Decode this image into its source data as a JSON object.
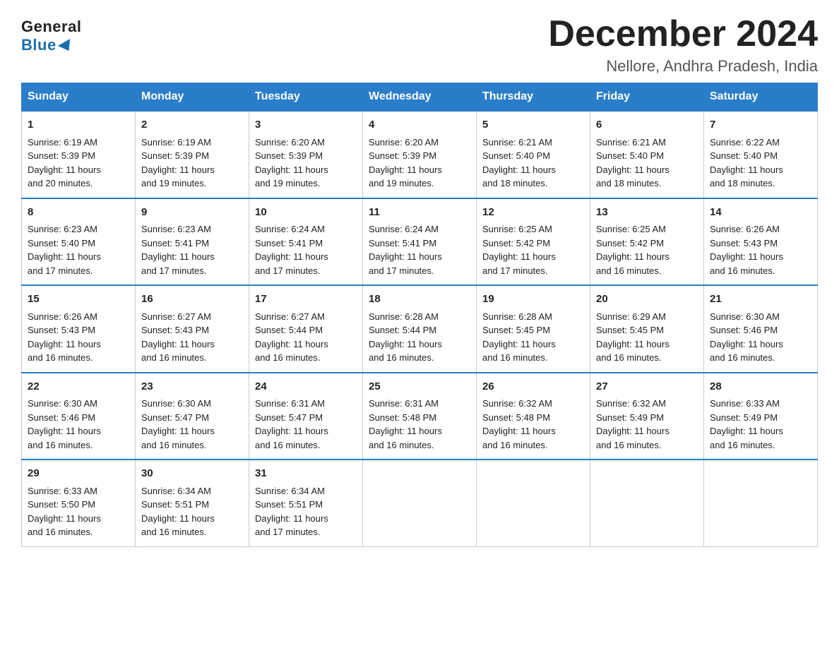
{
  "header": {
    "logo_general": "General",
    "logo_blue": "Blue",
    "month_title": "December 2024",
    "location": "Nellore, Andhra Pradesh, India"
  },
  "days_of_week": [
    "Sunday",
    "Monday",
    "Tuesday",
    "Wednesday",
    "Thursday",
    "Friday",
    "Saturday"
  ],
  "weeks": [
    [
      {
        "day": "1",
        "sunrise": "6:19 AM",
        "sunset": "5:39 PM",
        "daylight": "11 hours and 20 minutes."
      },
      {
        "day": "2",
        "sunrise": "6:19 AM",
        "sunset": "5:39 PM",
        "daylight": "11 hours and 19 minutes."
      },
      {
        "day": "3",
        "sunrise": "6:20 AM",
        "sunset": "5:39 PM",
        "daylight": "11 hours and 19 minutes."
      },
      {
        "day": "4",
        "sunrise": "6:20 AM",
        "sunset": "5:39 PM",
        "daylight": "11 hours and 19 minutes."
      },
      {
        "day": "5",
        "sunrise": "6:21 AM",
        "sunset": "5:40 PM",
        "daylight": "11 hours and 18 minutes."
      },
      {
        "day": "6",
        "sunrise": "6:21 AM",
        "sunset": "5:40 PM",
        "daylight": "11 hours and 18 minutes."
      },
      {
        "day": "7",
        "sunrise": "6:22 AM",
        "sunset": "5:40 PM",
        "daylight": "11 hours and 18 minutes."
      }
    ],
    [
      {
        "day": "8",
        "sunrise": "6:23 AM",
        "sunset": "5:40 PM",
        "daylight": "11 hours and 17 minutes."
      },
      {
        "day": "9",
        "sunrise": "6:23 AM",
        "sunset": "5:41 PM",
        "daylight": "11 hours and 17 minutes."
      },
      {
        "day": "10",
        "sunrise": "6:24 AM",
        "sunset": "5:41 PM",
        "daylight": "11 hours and 17 minutes."
      },
      {
        "day": "11",
        "sunrise": "6:24 AM",
        "sunset": "5:41 PM",
        "daylight": "11 hours and 17 minutes."
      },
      {
        "day": "12",
        "sunrise": "6:25 AM",
        "sunset": "5:42 PM",
        "daylight": "11 hours and 17 minutes."
      },
      {
        "day": "13",
        "sunrise": "6:25 AM",
        "sunset": "5:42 PM",
        "daylight": "11 hours and 16 minutes."
      },
      {
        "day": "14",
        "sunrise": "6:26 AM",
        "sunset": "5:43 PM",
        "daylight": "11 hours and 16 minutes."
      }
    ],
    [
      {
        "day": "15",
        "sunrise": "6:26 AM",
        "sunset": "5:43 PM",
        "daylight": "11 hours and 16 minutes."
      },
      {
        "day": "16",
        "sunrise": "6:27 AM",
        "sunset": "5:43 PM",
        "daylight": "11 hours and 16 minutes."
      },
      {
        "day": "17",
        "sunrise": "6:27 AM",
        "sunset": "5:44 PM",
        "daylight": "11 hours and 16 minutes."
      },
      {
        "day": "18",
        "sunrise": "6:28 AM",
        "sunset": "5:44 PM",
        "daylight": "11 hours and 16 minutes."
      },
      {
        "day": "19",
        "sunrise": "6:28 AM",
        "sunset": "5:45 PM",
        "daylight": "11 hours and 16 minutes."
      },
      {
        "day": "20",
        "sunrise": "6:29 AM",
        "sunset": "5:45 PM",
        "daylight": "11 hours and 16 minutes."
      },
      {
        "day": "21",
        "sunrise": "6:30 AM",
        "sunset": "5:46 PM",
        "daylight": "11 hours and 16 minutes."
      }
    ],
    [
      {
        "day": "22",
        "sunrise": "6:30 AM",
        "sunset": "5:46 PM",
        "daylight": "11 hours and 16 minutes."
      },
      {
        "day": "23",
        "sunrise": "6:30 AM",
        "sunset": "5:47 PM",
        "daylight": "11 hours and 16 minutes."
      },
      {
        "day": "24",
        "sunrise": "6:31 AM",
        "sunset": "5:47 PM",
        "daylight": "11 hours and 16 minutes."
      },
      {
        "day": "25",
        "sunrise": "6:31 AM",
        "sunset": "5:48 PM",
        "daylight": "11 hours and 16 minutes."
      },
      {
        "day": "26",
        "sunrise": "6:32 AM",
        "sunset": "5:48 PM",
        "daylight": "11 hours and 16 minutes."
      },
      {
        "day": "27",
        "sunrise": "6:32 AM",
        "sunset": "5:49 PM",
        "daylight": "11 hours and 16 minutes."
      },
      {
        "day": "28",
        "sunrise": "6:33 AM",
        "sunset": "5:49 PM",
        "daylight": "11 hours and 16 minutes."
      }
    ],
    [
      {
        "day": "29",
        "sunrise": "6:33 AM",
        "sunset": "5:50 PM",
        "daylight": "11 hours and 16 minutes."
      },
      {
        "day": "30",
        "sunrise": "6:34 AM",
        "sunset": "5:51 PM",
        "daylight": "11 hours and 16 minutes."
      },
      {
        "day": "31",
        "sunrise": "6:34 AM",
        "sunset": "5:51 PM",
        "daylight": "11 hours and 17 minutes."
      },
      null,
      null,
      null,
      null
    ]
  ],
  "labels": {
    "sunrise_prefix": "Sunrise: ",
    "sunset_prefix": "Sunset: ",
    "daylight_prefix": "Daylight: "
  }
}
